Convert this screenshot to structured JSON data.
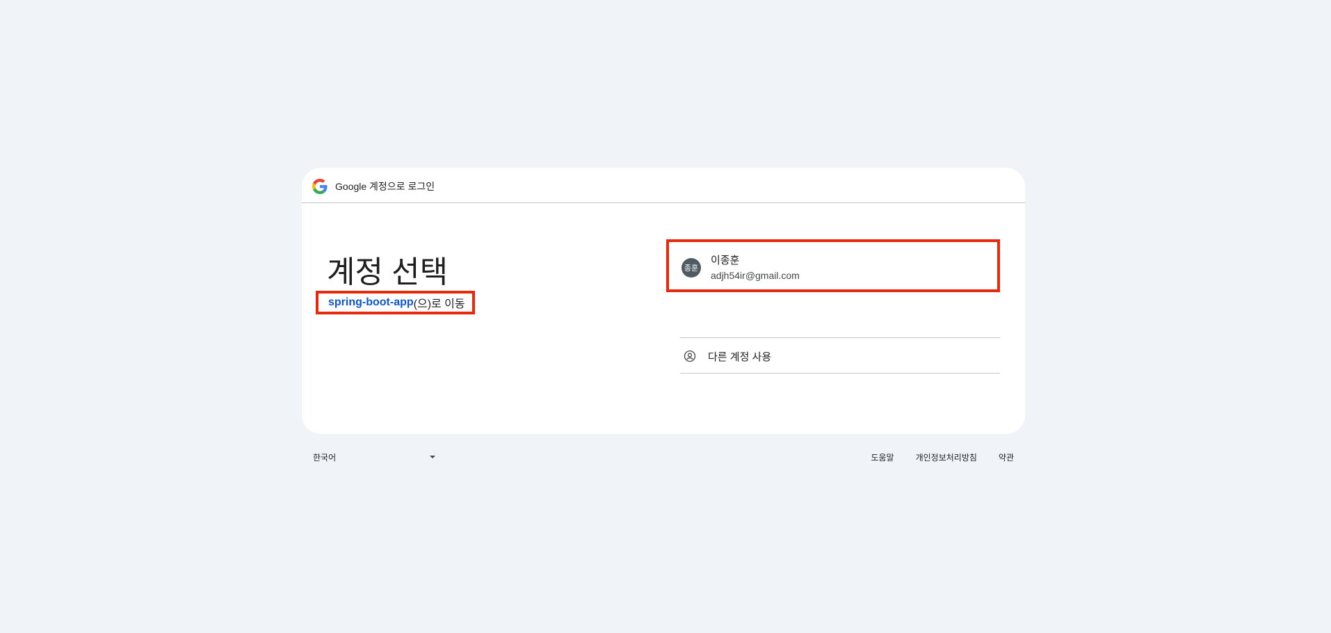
{
  "header": {
    "title": "Google 계정으로 로그인",
    "logo_icon": "google-g-icon"
  },
  "main": {
    "title": "계정 선택",
    "subtitle": {
      "app_name": "spring-boot-app",
      "suffix": "(으)로 이동"
    }
  },
  "account": {
    "avatar_text": "종훈",
    "name": "이종훈",
    "email": "adjh54ir@gmail.com"
  },
  "other_account": {
    "label": "다른 계정 사용",
    "icon": "person-circle-icon"
  },
  "footer": {
    "language": "한국어",
    "links": [
      "도움말",
      "개인정보처리방침",
      "약관"
    ]
  },
  "colors": {
    "background": "#f0f4f9",
    "link_blue": "#0b57d0",
    "highlight_red": "#e8290b",
    "avatar_bg": "#4f5b62"
  }
}
